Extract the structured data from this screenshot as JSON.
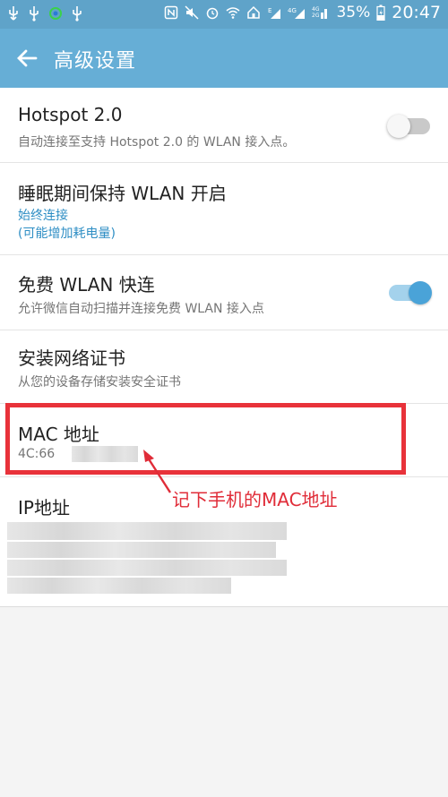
{
  "status_bar": {
    "left_icons": [
      "usb-icon",
      "notification-app-icon",
      "usb-icon",
      "usb-icon"
    ],
    "right_icons": [
      "nfc-icon",
      "mute-icon",
      "alarm-icon",
      "wifi-icon",
      "home-icon",
      "signal-e-icon",
      "signal-4g-icon",
      "signal-4g-icon"
    ],
    "battery": "35%",
    "time": "20:47"
  },
  "app_bar": {
    "title": "高级设置",
    "back_icon": "arrow-left-icon"
  },
  "settings": {
    "hotspot": {
      "title": "Hotspot 2.0",
      "subtitle": "自动连接至支持 Hotspot 2.0 的 WLAN 接入点。",
      "enabled": false
    },
    "sleep": {
      "title": "睡眠期间保持 WLAN 开启",
      "value": "始终连接",
      "note": "(可能增加耗电量)"
    },
    "free_wlan": {
      "title": "免费 WLAN 快连",
      "subtitle": "允许微信自动扫描并连接免费 WLAN 接入点",
      "enabled": true
    },
    "cert": {
      "title": "安装网络证书",
      "subtitle": "从您的设备存储安装安全证书"
    },
    "mac": {
      "title": "MAC 地址",
      "value": "4C:66"
    },
    "ip": {
      "title": "IP地址"
    }
  },
  "annotation": {
    "text": "记下手机的MAC地址"
  },
  "colors": {
    "status_bar": "#5fa3c9",
    "app_bar": "#66aed6",
    "accent": "#4aa3d8",
    "annotation": "#e02c38",
    "value_blue": "#2e8ec4"
  }
}
